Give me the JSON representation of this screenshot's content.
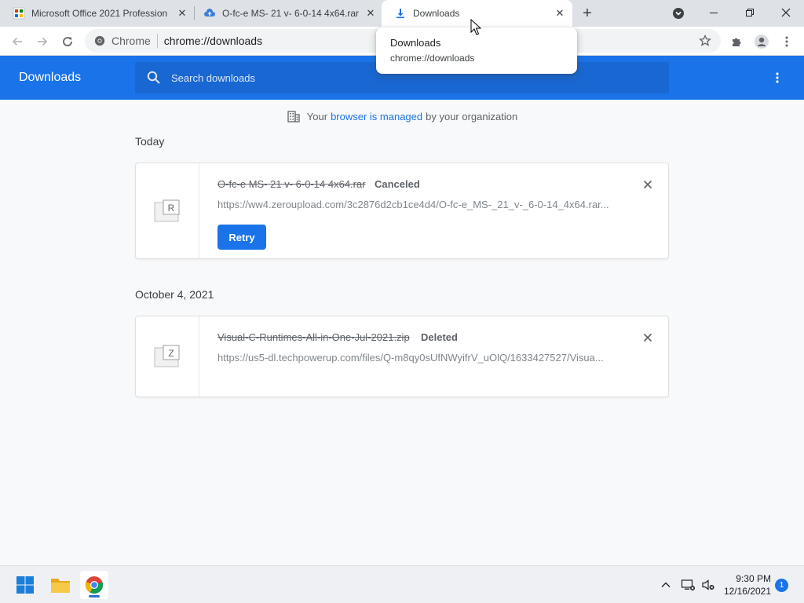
{
  "browser": {
    "tabs": [
      {
        "title": "Microsoft Office 2021 Profession",
        "favicon": "office-favicon-icon",
        "active": false
      },
      {
        "title": "O-fc-e MS- 21 v- 6-0-14 4x64.rar",
        "favicon": "cloud-upload-icon",
        "active": false
      },
      {
        "title": "Downloads",
        "favicon": "download-icon",
        "active": true
      }
    ],
    "omnibox": {
      "chip": "Chrome",
      "url": "chrome://downloads"
    },
    "hover_card": {
      "title": "Downloads",
      "url": "chrome://downloads"
    }
  },
  "downloads_page": {
    "title": "Downloads",
    "search_placeholder": "Search downloads",
    "managed": {
      "prefix": "Your",
      "link": "browser is managed",
      "suffix": "by your organization"
    },
    "groups": [
      {
        "date": "Today",
        "items": [
          {
            "file_name": "O-fc-e MS- 21 v- 6-0-14 4x64.rar",
            "status": "Canceled",
            "url": "https://ww4.zeroupload.com/3c2876d2cb1ce4d4/O-fc-e_MS-_21_v-_6-0-14_4x64.rar...",
            "file_type_letter": "R",
            "action": "Retry"
          }
        ]
      },
      {
        "date": "October 4, 2021",
        "items": [
          {
            "file_name": "Visual-C-Runtimes-All-in-One-Jul-2021.zip",
            "status": "Deleted",
            "url": "https://us5-dl.techpowerup.com/files/Q-m8qy0sUfNWyifrV_uOlQ/1633427527/Visua...",
            "file_type_letter": "Z"
          }
        ]
      }
    ]
  },
  "taskbar": {
    "time": "9:30 PM",
    "date": "12/16/2021",
    "notification_count": "1"
  },
  "colors": {
    "accent": "#1a73e8",
    "header_search": "#1967d2",
    "tabstrip": "#dee1e6"
  }
}
